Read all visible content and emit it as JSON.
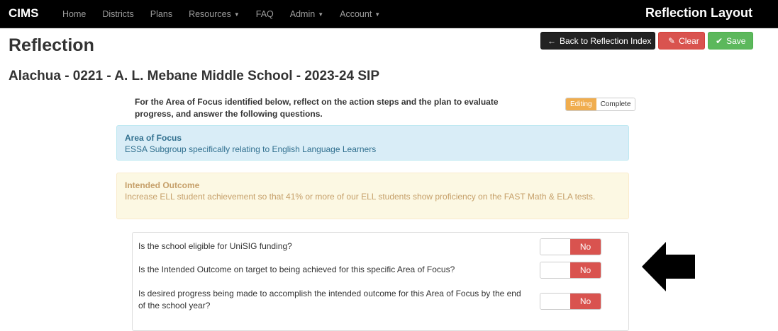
{
  "navbar": {
    "brand": "CIMS",
    "items": [
      {
        "label": "Home"
      },
      {
        "label": "Districts"
      },
      {
        "label": "Plans"
      },
      {
        "label": "Resources",
        "caret": "▼"
      },
      {
        "label": "FAQ"
      },
      {
        "label": "Admin",
        "caret": "▼"
      },
      {
        "label": "Account",
        "caret": "▼"
      }
    ],
    "right_title": "Reflection Layout"
  },
  "page": {
    "title": "Reflection",
    "subtitle": "Alachua - 0221 - A. L. Mebane Middle School - 2023-24 SIP"
  },
  "toolbar": {
    "back_label": "Back to Reflection Index",
    "back_icon": "←",
    "clear_label": "Clear",
    "clear_icon": "✎",
    "save_label": "Save",
    "save_icon": "✔"
  },
  "instructions": "For the Area of Focus identified below, reflect on the action steps and the plan to evaluate progress, and answer the following questions.",
  "status_toggle": {
    "editing": "Editing",
    "complete": "Complete",
    "active_color": "#f0ad4e"
  },
  "area_of_focus": {
    "title": "Area of Focus",
    "text": "ESSA Subgroup specifically relating to English Language Learners"
  },
  "intended_outcome": {
    "title": "Intended Outcome",
    "text": "Increase ELL student achievement so that 41% or more of our ELL students show proficiency on the FAST Math & ELA tests."
  },
  "questions": [
    {
      "text": "Is the school eligible for UniSIG funding?",
      "answer": "No"
    },
    {
      "text": "Is the Intended Outcome on target to being achieved for this specific Area of Focus?",
      "answer": "No"
    },
    {
      "text": "Is desired progress being made to accomplish the intended outcome for this Area of Focus by the end of the school year?",
      "answer": "No"
    }
  ],
  "colors": {
    "navbar_bg": "#000000",
    "danger": "#d9534f",
    "success": "#5cb85c",
    "info_bg": "#d9edf7",
    "warning_bg": "#fcf8e3"
  }
}
